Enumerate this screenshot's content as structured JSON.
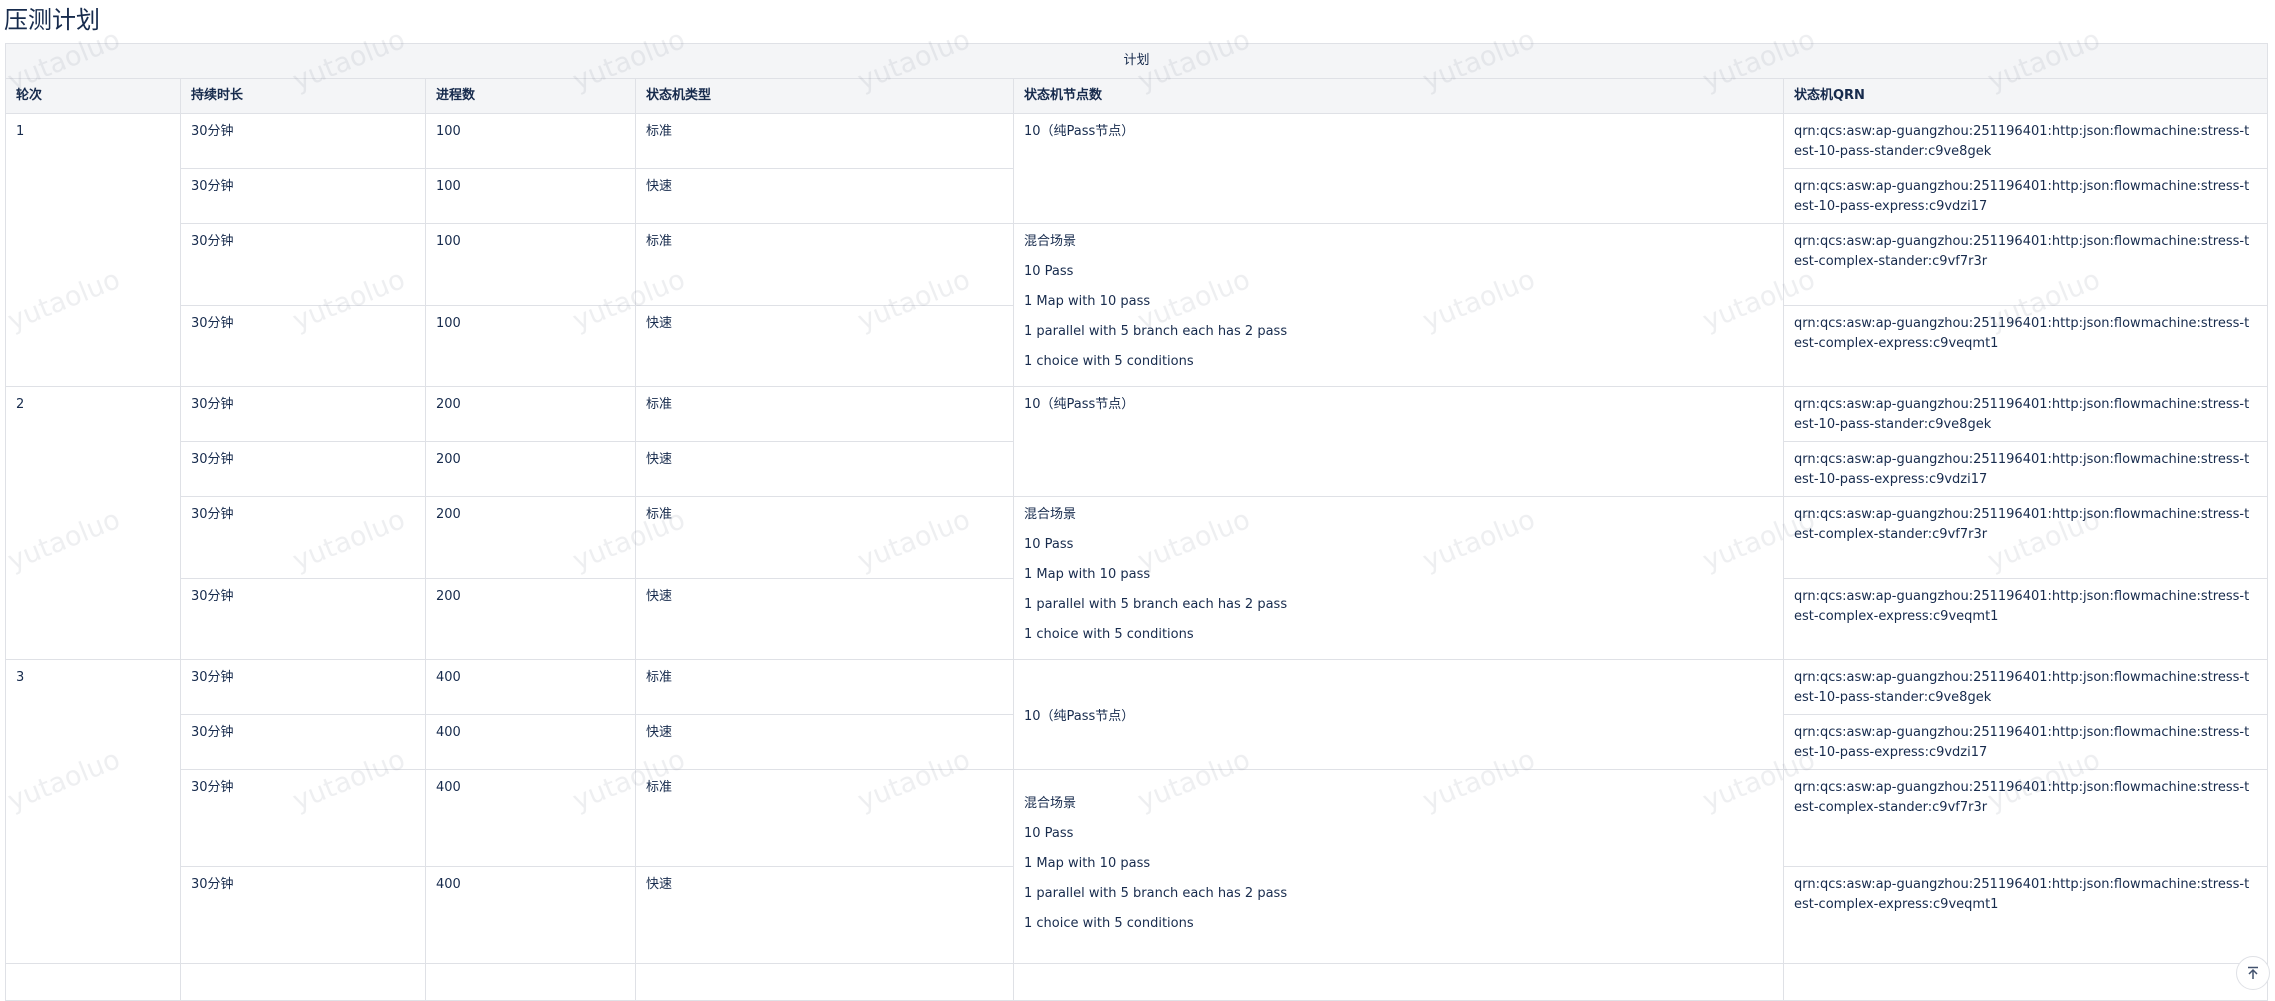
{
  "page": {
    "title": "压测计划"
  },
  "table": {
    "caption": "计划",
    "headers": [
      "轮次",
      "持续时长",
      "进程数",
      "状态机类型",
      "状态机节点数",
      "状态机QRN"
    ],
    "rounds": [
      "1",
      "2",
      "3"
    ],
    "duration": "30分钟",
    "processes": [
      "100",
      "200",
      "400"
    ],
    "types": {
      "standard": "标准",
      "express": "快速"
    },
    "nodes_simple": "10（纯Pass节点）",
    "mixed_scene": [
      "混合场景",
      "10 Pass",
      "1 Map with 10 pass",
      "1 parallel with 5 branch each has 2 pass",
      "1 choice with 5 conditions"
    ],
    "qrns": [
      "qrn:qcs:asw:ap-guangzhou:251196401:http:json:flowmachine:stress-test-10-pass-stander:c9ve8gek",
      "qrn:qcs:asw:ap-guangzhou:251196401:http:json:flowmachine:stress-test-10-pass-express:c9vdzi17",
      "qrn:qcs:asw:ap-guangzhou:251196401:http:json:flowmachine:stress-test-complex-stander:c9vf7r3r",
      "qrn:qcs:asw:ap-guangzhou:251196401:http:json:flowmachine:stress-test-complex-express:c9veqmt1"
    ]
  },
  "watermark": {
    "text": "yutaoluo"
  },
  "icons": {
    "back_to_top": "arrow-up-to-top-icon"
  }
}
